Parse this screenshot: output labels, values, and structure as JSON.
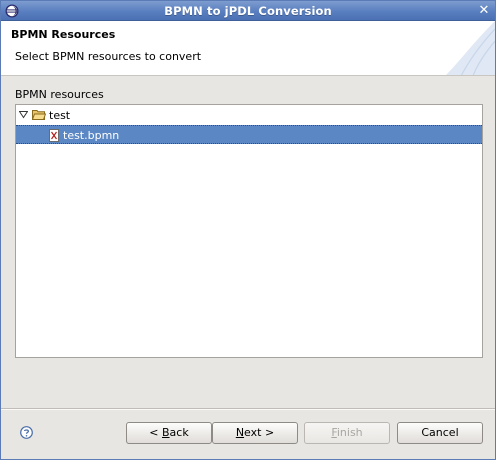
{
  "window": {
    "title": "BPMN to jPDL Conversion",
    "close_glyph": "✕",
    "app_icon": "eclipse-icon"
  },
  "header": {
    "title": "BPMN Resources",
    "message": "Select BPMN resources to convert"
  },
  "resources": {
    "label": "BPMN resources",
    "tree": [
      {
        "label": "test",
        "expanded": true,
        "icon": "folder-open-icon",
        "children": [
          {
            "label": "test.bpmn",
            "icon": "bpmn-file-icon",
            "selected": true
          }
        ]
      }
    ],
    "selection_color": "#5b87c4"
  },
  "buttons": {
    "back_prefix": "< ",
    "back_mnemonic": "B",
    "back_rest": "ack",
    "next_mnemonic": "N",
    "next_rest": "ext >",
    "finish_mnemonic": "F",
    "finish_rest": "inish",
    "finish_enabled": false,
    "cancel": "Cancel"
  },
  "help_icon": "help-icon"
}
